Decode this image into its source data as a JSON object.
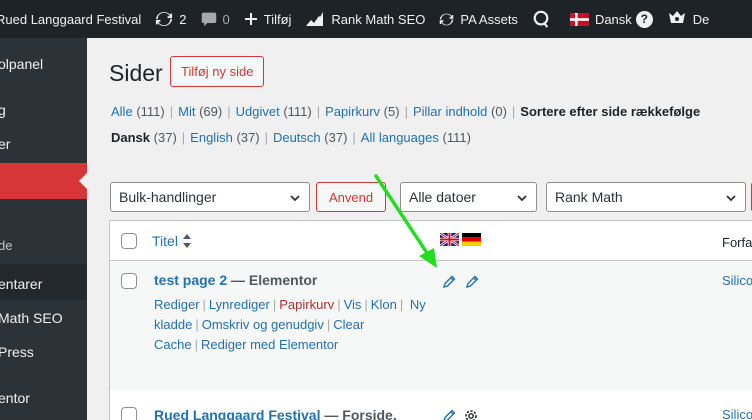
{
  "adminbar": {
    "site_name": "Rued Langgaard Festival",
    "updates_count": "2",
    "comments_count": "0",
    "new_label": "Tilføj",
    "rankmath_label": "Rank Math SEO",
    "pa_assets_label": "PA Assets",
    "language_label": "Dansk",
    "help_label": "?",
    "user_label": "De"
  },
  "sidebar": {
    "items": [
      {
        "label": "olpanel"
      },
      {
        "label": "g"
      },
      {
        "label": "er"
      },
      {
        "label": ""
      },
      {
        "label": "de"
      },
      {
        "label": "entarer"
      },
      {
        "label": "Math SEO"
      },
      {
        "label": "Press"
      },
      {
        "label": "entor"
      }
    ]
  },
  "page": {
    "title": "Sider",
    "add_new_label": "Tilføj ny side"
  },
  "status_filters": [
    {
      "label": "Alle",
      "count": "(111)"
    },
    {
      "label": "Mit",
      "count": "(69)"
    },
    {
      "label": "Udgivet",
      "count": "(111)"
    },
    {
      "label": "Papirkurv",
      "count": "(5)"
    },
    {
      "label": "Pillar indhold",
      "count": "(0)"
    },
    {
      "label": "Sortere efter side rækkefølge",
      "count": ""
    }
  ],
  "language_filters": [
    {
      "label": "Dansk",
      "count": "(37)"
    },
    {
      "label": "English",
      "count": "(37)"
    },
    {
      "label": "Deutsch",
      "count": "(37)"
    },
    {
      "label": "All languages",
      "count": "(111)"
    }
  ],
  "toolbar": {
    "bulk_actions": "Bulk-handlinger",
    "apply_label": "Anvend",
    "dates": "Alle datoer",
    "rankmath_filter": "Rank Math"
  },
  "table": {
    "header": {
      "title": "Titel",
      "author": "Forfa"
    },
    "rows": [
      {
        "title": "test page 2",
        "state": "— Elementor",
        "actions": [
          "Rediger",
          "Lynrediger",
          "Papirkurv",
          "Vis",
          "Klon",
          "Ny kladde",
          "Omskriv og genudgiv",
          "Clear Cache",
          "Rediger med Elementor"
        ],
        "author": "Silico"
      },
      {
        "title": "Rued Langgaard Festival",
        "state": "— Forside,",
        "author": "Silico"
      }
    ]
  },
  "colors": {
    "accent": "#d63638",
    "link": "#2271b1",
    "adminbar": "#1d2327",
    "sidebar": "#2c3338",
    "annotation_arrow": "#22dd22"
  }
}
